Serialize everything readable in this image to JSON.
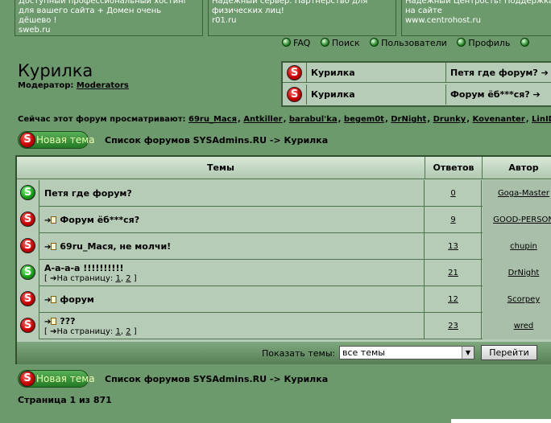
{
  "ads": [
    {
      "line1": "Доступный профессиональный хостинг",
      "line2": "для вашего сайта + Домен очень",
      "line3": "дёшево !",
      "url": "sweb.ru"
    },
    {
      "line1": "Надёжный сервер. Партнерство для",
      "line2": "физических лиц!",
      "line3": "",
      "url": "r01.ru"
    },
    {
      "line1": "Надёжный Центрость! Поддержка",
      "line2": "на сайте",
      "line3": "",
      "url": "www.centrohost.ru"
    }
  ],
  "nav": {
    "faq": "FAQ",
    "search": "Поиск",
    "users": "Пользователи",
    "profile": "Профиль"
  },
  "forum": {
    "title": "Курилка",
    "moderator_label": "Модератор:",
    "moderator_link": "Moderators"
  },
  "recent": [
    {
      "forum": "Курилка",
      "topic": "Петя где форум? ➔"
    },
    {
      "forum": "Курилка",
      "topic": "Форум ёб***ся? ➔"
    }
  ],
  "viewing": {
    "label": "Сейчас этот форум просматривают:",
    "users": [
      "69ru_Мася",
      "Antkiller",
      "barabul'ka",
      "begem0t",
      "DrNight",
      "Drunky",
      "Kovenanter",
      "LinID"
    ]
  },
  "new_topic_label": "Новая тема",
  "breadcrumb": "Список форумов SYSAdmins.RU -> Курилка",
  "table": {
    "headers": {
      "topics": "Темы",
      "replies": "Ответов",
      "author": "Автор"
    },
    "rows": [
      {
        "title": "Петя где форум?",
        "replies": "0",
        "author": "Goga-Master",
        "hot": false,
        "moved": false,
        "pages": null
      },
      {
        "title": "Форум ёб***ся?",
        "replies": "9",
        "author": "GOOD-PERSON",
        "hot": true,
        "moved": true,
        "pages": null
      },
      {
        "title": "69ru_Мася, не молчи!",
        "replies": "13",
        "author": "chupin",
        "hot": true,
        "moved": true,
        "pages": null
      },
      {
        "title": "А-а-а-а !!!!!!!!!!",
        "replies": "21",
        "author": "DrNight",
        "hot": false,
        "moved": false,
        "pages": [
          "1",
          "2"
        ]
      },
      {
        "title": "форум",
        "replies": "12",
        "author": "Scorpey",
        "hot": true,
        "moved": true,
        "pages": null
      },
      {
        "title": "???",
        "replies": "23",
        "author": "wred",
        "hot": true,
        "moved": true,
        "pages": [
          "1",
          "2"
        ]
      }
    ],
    "pages_label": "На страницу:"
  },
  "footer": {
    "show_label": "Показать темы:",
    "select_value": "все темы",
    "go_button": "Перейти"
  },
  "page_info": "Страница 1 из 871"
}
